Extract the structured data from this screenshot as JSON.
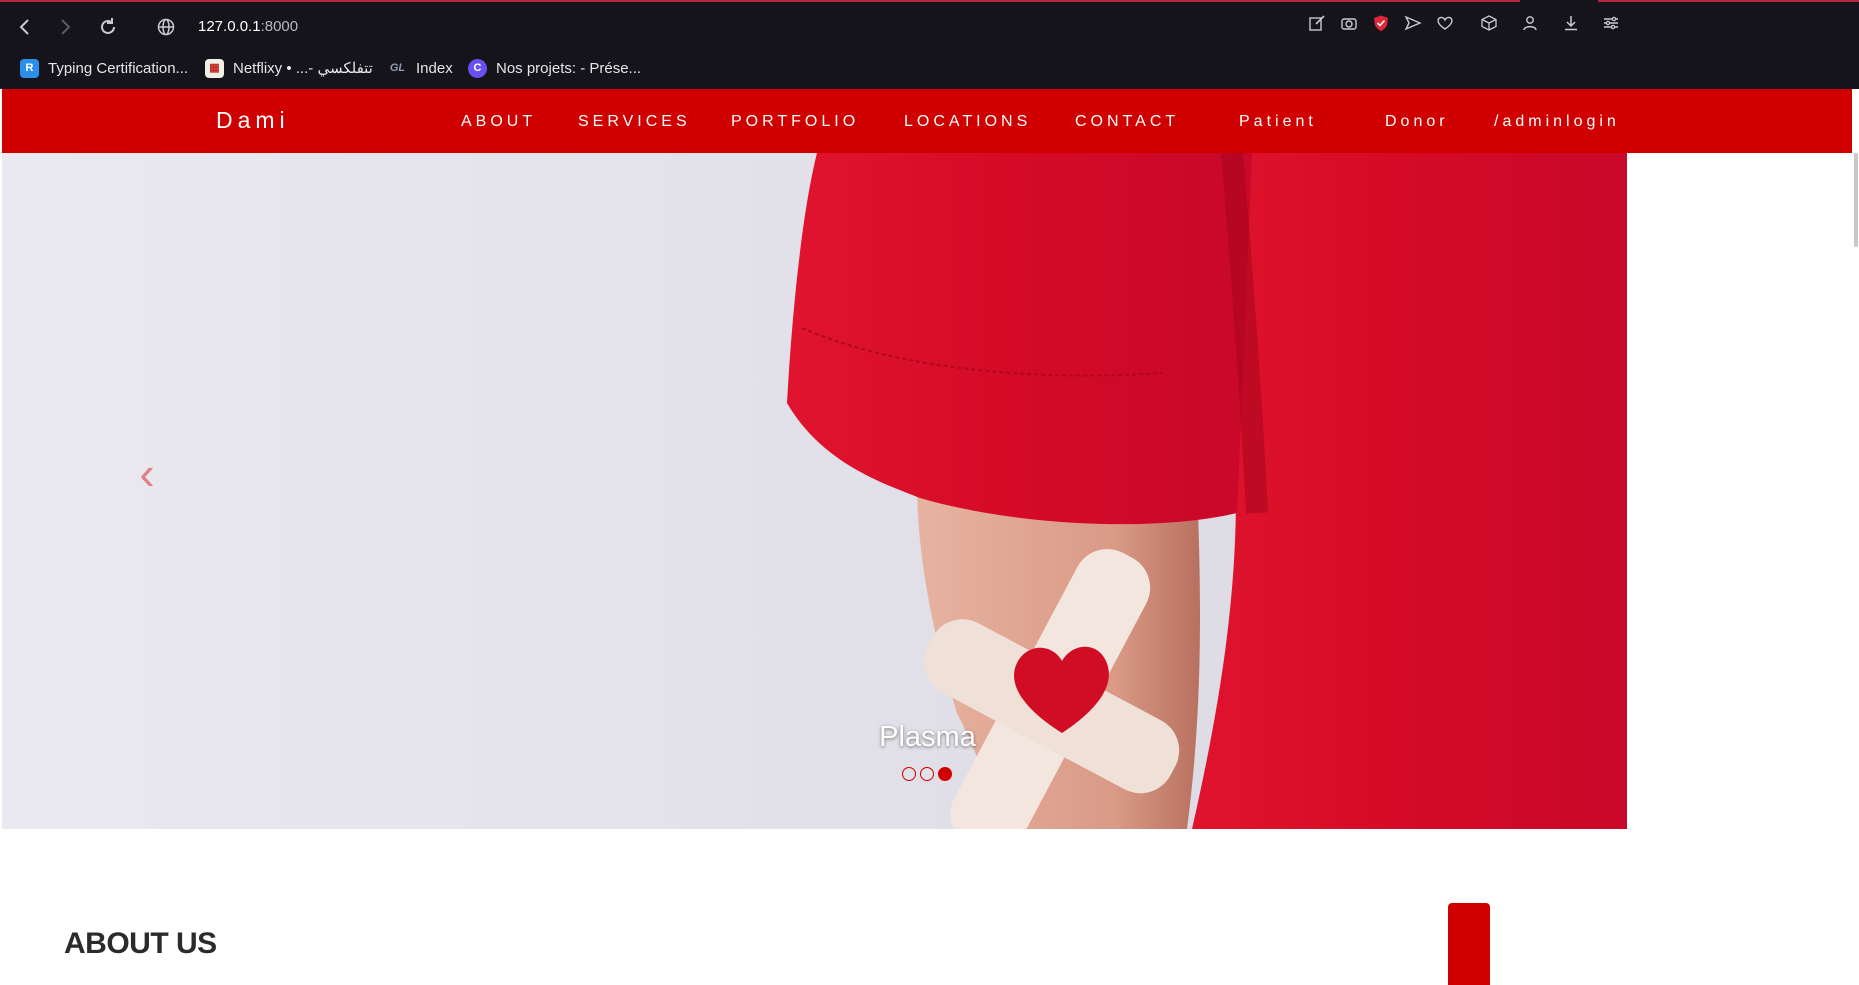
{
  "browser": {
    "url_host": "127.0.0.1",
    "url_port": ":8000",
    "bookmarks": [
      {
        "label": "Typing Certification...",
        "icon": "typing-icon"
      },
      {
        "label": "Netflixy • ...- تتفلكسي",
        "icon": "netflixy-icon"
      },
      {
        "label": "Index",
        "icon": "gl-icon"
      },
      {
        "label": "Nos projets: - Prése...",
        "icon": "canva-icon"
      }
    ]
  },
  "navbar": {
    "brand": "Dami",
    "items": [
      "ABOUT",
      "SERVICES",
      "PORTFOLIO",
      "LOCATIONS",
      "CONTACT",
      "Patient",
      "Donor",
      "/adminlogin"
    ]
  },
  "carousel": {
    "caption": "Plasma",
    "indicator_count": 3,
    "active_index": 2,
    "prev_glyph": "‹",
    "next_glyph": "›"
  },
  "about": {
    "title": "ABOUT US"
  },
  "colors": {
    "brand_red": "#d10000",
    "chrome_bg": "#15141a"
  }
}
